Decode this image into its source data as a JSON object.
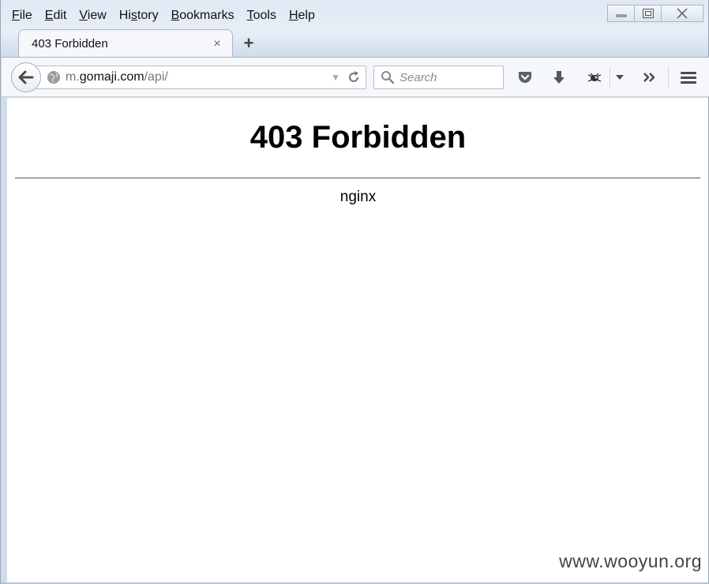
{
  "menubar": {
    "items": [
      {
        "label": "File",
        "accel": "F",
        "rest": "ile"
      },
      {
        "label": "Edit",
        "accel": "E",
        "rest": "dit"
      },
      {
        "label": "View",
        "accel": "V",
        "rest": "iew"
      },
      {
        "label": "History",
        "pre": "Hi",
        "accel": "s",
        "rest": "tory"
      },
      {
        "label": "Bookmarks",
        "accel": "B",
        "rest": "ookmarks"
      },
      {
        "label": "Tools",
        "accel": "T",
        "rest": "ools"
      },
      {
        "label": "Help",
        "accel": "H",
        "rest": "elp"
      }
    ]
  },
  "tab": {
    "title": "403 Forbidden",
    "close": "×"
  },
  "newtab": {
    "label": "+"
  },
  "urlbar": {
    "prefix": "m.",
    "host": "gomaji.com",
    "path": "/api/"
  },
  "searchbar": {
    "placeholder": "Search"
  },
  "page": {
    "heading": "403 Forbidden",
    "server": "nginx"
  },
  "watermark": "www.wooyun.org",
  "icons": {
    "back": "back-arrow-icon",
    "site": "globe-icon",
    "reload": "reload-icon",
    "search": "search-icon",
    "pocket": "pocket-icon",
    "downloads": "download-arrow-icon",
    "extension": "bug-extension-icon",
    "overflow": "chevron-double-right-icon",
    "menu": "hamburger-menu-icon"
  }
}
